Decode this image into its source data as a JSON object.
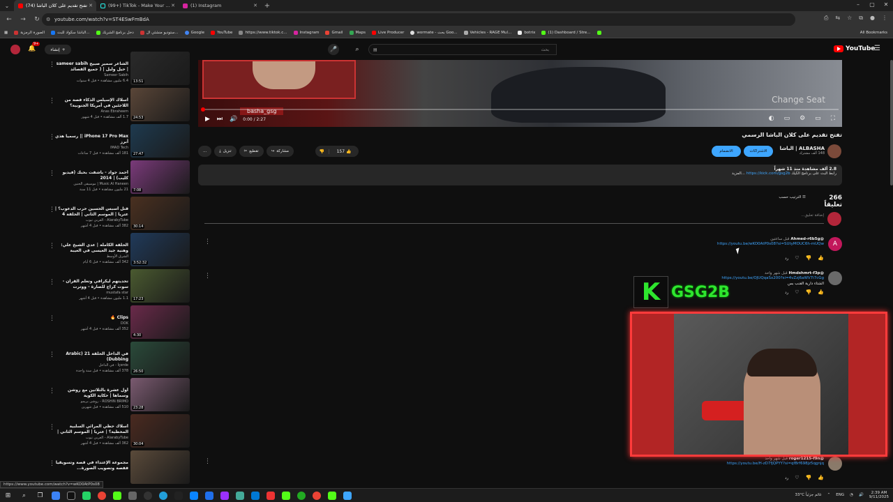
{
  "browser": {
    "tabs": [
      {
        "title": "(74) تفتح تقديم على كلان الباشا",
        "active": true,
        "color": "#ff0000"
      },
      {
        "title": "(99+) TikTok - Make Your Day",
        "active": false,
        "color": "#111111"
      },
      {
        "title": "(1) Instagram",
        "active": false,
        "color": "#d6249f"
      }
    ],
    "url": "youtube.com/watch?v=ST4ESwFmBdA",
    "bookmarks": [
      "الصورة الرمزية",
      "الباشا سكواد للبث...",
      "دخل برنامج الشريك",
      "ستوديو منشئي ال...",
      "Google",
      "YouTube",
      "https://www.tiktok.c...",
      "Instagram",
      "Gmail",
      "Maps",
      "Live Producer",
      "wormate - بحث Goo...",
      "Vehicles - RAGE Mul...",
      "botrix",
      "(1) Dashboard / Stre..."
    ],
    "all_bookmarks": "All Bookmarks",
    "status_url": "https://www.youtube.com/watch?v=wKO0AtP0s08"
  },
  "yt": {
    "create_label": "إنشاء",
    "notif_count": "9+",
    "search_placeholder": "بحث",
    "logo_text": "YouTube"
  },
  "recommendations": [
    {
      "title": "الشاعر سمير صبيح sameer sabih | حيل وليل | ( جميع القصائد المطروحة في برنا...",
      "channel": "Sameer Sabih",
      "meta": "6.4 مليون مشاهدة • قبل 4 سنوات",
      "duration": "13:51",
      "color": "#2a2a2a"
    },
    {
      "title": "أسلاك الإسيلس الذكاء قصة من اللاجئين في أمريكا الجنوبية؟",
      "channel": "Anas Ebraheem",
      "meta": "1.7 ألف مشاهدة • قبل 4 شهور",
      "duration": "24:53",
      "color": "#5a4638"
    },
    {
      "title": "iPhone 17 Pro Max || رسمياً هذي أبرز",
      "channel": "IMAD Tech",
      "meta": "181 ألف مشاهدة • قبل 7 ساعات",
      "duration": "27:47",
      "color": "#1e3a4f"
    },
    {
      "title": "أحمد جواد - باشفت بحبك (فيديو كليب) | 2014",
      "channel": "Music Al Haneen | موسيقى الحنين",
      "meta": "21 مليون مشاهدة • قبل 11 سنة",
      "duration": "7:08",
      "color": "#7a3a7a"
    },
    {
      "title": "قتل أسبس الحسين حرب الدعوب؟ | عتريا | الموسم الثاني | الحلقة 4",
      "channel": "AlarabyTube - العربي تيوب",
      "meta": "382 ألف مشاهدة • قبل 4 أشهر",
      "duration": "30:14",
      "color": "#4a3020"
    },
    {
      "title": "الحلقة الكاملة | عدي الشيخ علي: وهنية جيد العيسى في الغيبة ومخابرا السارسة الحراقية",
      "channel": "الشرق الأوسط",
      "meta": "342 ألف مشاهدة • قبل 6 أيام",
      "duration": "3:52:32",
      "color": "#203a5a"
    },
    {
      "title": "تحديتهم ليكرافي وتعلم القرآن - سوت كراج للصارة - ووترت مستقبلي القرية | vlog",
      "channel": "mustafa star",
      "meta": "1.1 مليون مشاهدة • قبل 4 أشهر",
      "duration": "17:23",
      "color": "#4a5a30"
    },
    {
      "title": "Clips 🔥",
      "channel": "DOK",
      "meta": "352 ألف مشاهدة • قبل 4 أشهر",
      "duration": "4:30",
      "color": "#6a2a4a"
    },
    {
      "title": "في الداخل الحلقة 21 (Arabic Dubbing)",
      "channel": "İçerde - في الداخل",
      "meta": "378 ألف مشاهدة • قبل سنة واحدة",
      "duration": "26:50",
      "color": "#2a4a3a"
    },
    {
      "title": "أول عشرة بالثلاثين مع روشن وسماها | حكاية الكوية",
      "channel": "ROSHIN BRIMO - روشن بريمو",
      "meta": "510 ألف مشاهدة • قبل شهرين",
      "duration": "23:28",
      "color": "#7a5a70"
    },
    {
      "title": "أسلاك حظي المرائي السلبية المحطية؟ | عتريا | الموسم الثاني | الحلقة 17",
      "channel": "AlarabyTube - العربي تيوب",
      "meta": "362 ألف مشاهدة • قبل 4 أشهر",
      "duration": "30:04",
      "color": "#4a2a20"
    },
    {
      "title": "مجموعة الإعتداء في قصة وتسويقيا ففصة وتصويب الصورة...",
      "channel": "",
      "meta": "",
      "duration": "",
      "color": "#5a4a3a"
    }
  ],
  "player": {
    "time": "0:00 / 2:27",
    "watermark": "basha_gsg",
    "overlay_text": "Change Seat"
  },
  "video": {
    "title": "تفتح تقديم على كلان الباشا الرسمي",
    "channel": "ALBASHA | الباشا",
    "subs": "148 ألف مشترك",
    "subscribe_label": "الاشتراكات",
    "join_label": "الانضمام",
    "likes": "157",
    "share_label": "مشاركة",
    "remix_label": "تقطيع",
    "download_label": "تنزيل",
    "more_label": "...",
    "desc_line1": "2.8 ألف مشاهدة منذ 11 شهراً",
    "desc_line2": "رابط البث على برنامج الكيك",
    "desc_link": "https://kick.com/gsg2b",
    "desc_more": "...المزيد"
  },
  "comments_section": {
    "count": "266 تعليقاً",
    "sort_label": "الترتيب حسب",
    "add_placeholder": "إضافة تعليق..."
  },
  "comments": [
    {
      "author": "@Ahmed-r6b5g",
      "time": "قبل ساعتين",
      "link": "https://youtu.be/wKO0AtP0s08?si=SUtyMOUC6h-mUQw",
      "text": "",
      "avatar": "A",
      "color": "#c2185b"
    },
    {
      "author": "@Hmdshmrt-f3p",
      "time": "قبل شهر واحد",
      "link": "https://youtu.be/OJUQqaSx200?si=4vZzj6aWV7i7cGg",
      "text": "الشتاء دارية القنب بس",
      "avatar": "",
      "color": "#6a6a6a"
    },
    {
      "author": "@roger1215-f9n",
      "time": "قبل شهر واحد",
      "link": "https://youtu.be/H-zD7fjQPYY?si=qf8rf698jz5qgnjq",
      "text": "",
      "avatar": "",
      "color": "#8a7a6a"
    }
  ],
  "stream_overlay": {
    "brand": "GSG2B",
    "k": "K"
  },
  "taskbar": {
    "weather": "33°C غائم جزئياً",
    "lang": "ENG",
    "time": "2:39 AM",
    "date": "9/11/2025"
  }
}
